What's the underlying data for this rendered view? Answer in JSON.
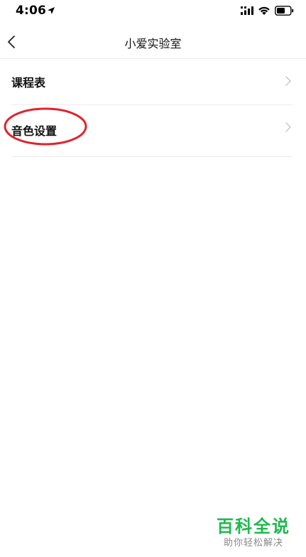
{
  "status_bar": {
    "time": "4:06",
    "icons": [
      "location-arrow-icon",
      "signal-icon",
      "wifi-icon",
      "battery-icon"
    ]
  },
  "nav": {
    "back_icon": "chevron-left-icon",
    "title": "小爱实验室"
  },
  "list": {
    "items": [
      {
        "label": "课程表",
        "icon": "chevron-right-icon"
      },
      {
        "label": "音色设置",
        "icon": "chevron-right-icon"
      }
    ]
  },
  "annotation": {
    "type": "red-circle-highlight",
    "target": "音色设置",
    "color": "#e0232d"
  },
  "watermark": {
    "title": "百科全说",
    "subtitle": "助你轻松解决",
    "color": "#1fb94f"
  },
  "colors": {
    "background": "#ffffff",
    "divider": "#ececec",
    "chevron": "#c4c4c4"
  }
}
